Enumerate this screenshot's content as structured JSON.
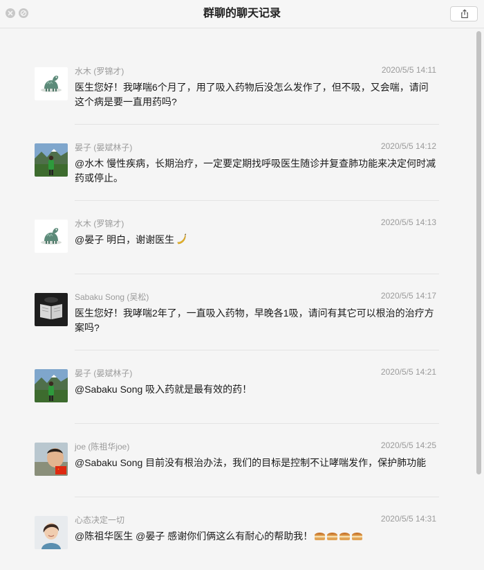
{
  "window": {
    "title": "群聊的聊天记录",
    "share_icon": "share-icon",
    "close_icon": "close-icon",
    "minimize_icon": "minimize-icon"
  },
  "messages": [
    {
      "sender": "水木 (罗锦才)",
      "time": "2020/5/5 14:11",
      "text": "医生您好！我哮喘6个月了，用了吸入药物后没怎么发作了，但不吸，又会喘，请问这个病是要一直用药吗?",
      "avatar": "dino-avatar"
    },
    {
      "sender": "晏子 (晏斌林子)",
      "time": "2020/5/5 14:12",
      "text": "@水木 慢性疾病，长期治疗，一定要定期找呼吸医生随诊并复查肺功能来决定何时减药或停止。",
      "avatar": "mountain-person-avatar"
    },
    {
      "sender": "水木 (罗锦才)",
      "time": "2020/5/5 14:13",
      "text": "@晏子 明白，谢谢医生",
      "emoji": "banana-emoji",
      "avatar": "dino-avatar"
    },
    {
      "sender": "Sabaku Song (吴松)",
      "time": "2020/5/5 14:17",
      "text": "医生您好！我哮喘2年了，一直吸入药物，早晚各1吸，请问有其它可以根治的治疗方案吗?",
      "avatar": "book-avatar"
    },
    {
      "sender": "晏子 (晏斌林子)",
      "time": "2020/5/5 14:21",
      "text": "@Sabaku Song 吸入药就是最有效的药！",
      "avatar": "mountain-person-avatar"
    },
    {
      "sender": "joe (陈祖华joe)",
      "time": "2020/5/5 14:25",
      "text": "@Sabaku Song 目前没有根治办法，我们的目标是控制不让哮喘发作，保护肺功能",
      "avatar": "portrait-flag-avatar"
    },
    {
      "sender": "心态决定一切",
      "time": "2020/5/5 14:31",
      "text": "@陈祖华医生 @晏子 感谢你们俩这么有耐心的帮助我！",
      "emoji": "cake-emoji x4",
      "avatar": "woman-avatar"
    }
  ]
}
